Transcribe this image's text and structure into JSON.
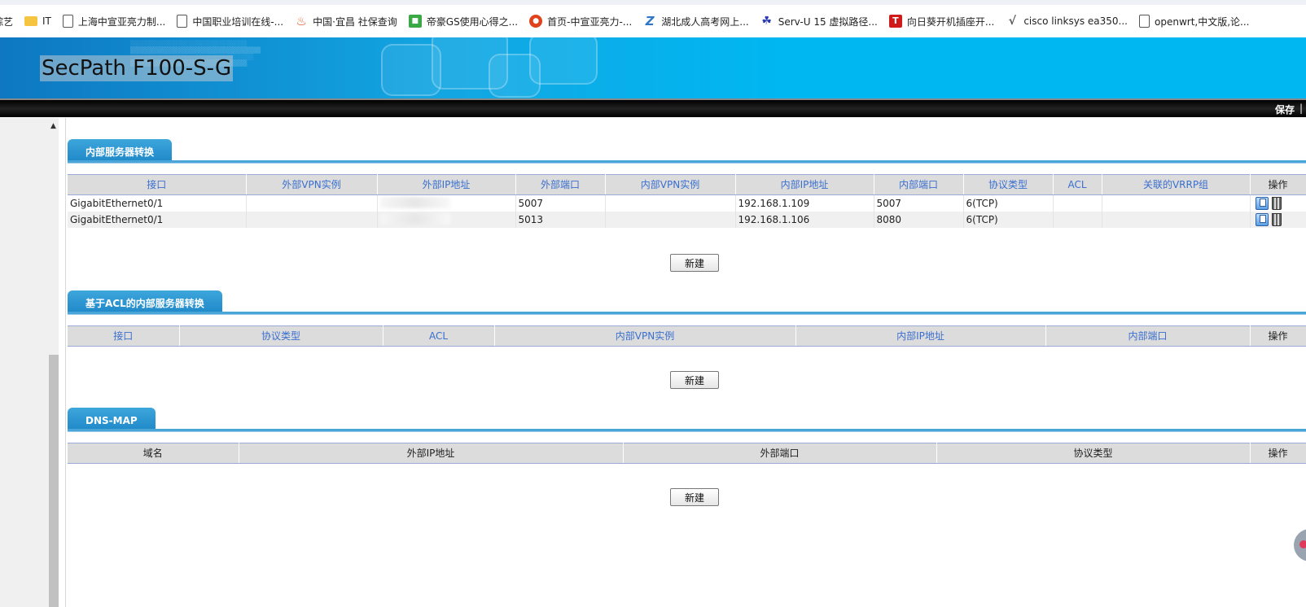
{
  "bookmarks": [
    {
      "label": "综艺",
      "icon": "none"
    },
    {
      "label": "IT",
      "icon": "folder-icon"
    },
    {
      "label": "上海中宣亚亮力制...",
      "icon": "document-icon"
    },
    {
      "label": "中国职业培训在线-...",
      "icon": "document-icon"
    },
    {
      "label": "中国·宜昌 社保查询",
      "icon": "flame-icon"
    },
    {
      "label": "帝豪GS使用心得之...",
      "icon": "green-logo-icon"
    },
    {
      "label": "首页-中宣亚亮力-...",
      "icon": "red-logo-icon"
    },
    {
      "label": "湖北成人高考网上...",
      "icon": "z-logo-icon"
    },
    {
      "label": "Serv-U 15 虚拟路径...",
      "icon": "paw-icon"
    },
    {
      "label": "向日葵开机插座开...",
      "icon": "t-logo-icon"
    },
    {
      "label": "cisco linksys ea350...",
      "icon": "cisco-icon"
    },
    {
      "label": "openwrt,中文版,论...",
      "icon": "document-icon"
    }
  ],
  "header": {
    "product_title": "SecPath F100-S-G",
    "save_label": "保存",
    "separator": "|"
  },
  "colors": {
    "banner_blue": "#00b7f1",
    "tab_blue": "#1f88c9",
    "header_text": "#3a6fd0",
    "toolbar": "#000000"
  },
  "sections": {
    "internal_server": {
      "title": "内部服务器转换",
      "columns": [
        "接口",
        "外部VPN实例",
        "外部IP地址",
        "外部端口",
        "内部VPN实例",
        "内部IP地址",
        "内部端口",
        "协议类型",
        "ACL",
        "关联的VRRP组",
        "操作"
      ],
      "rows": [
        {
          "interface": "GigabitEthernet0/1",
          "ext_vpn": "",
          "ext_ip": "",
          "ext_port": "5007",
          "int_vpn": "",
          "int_ip": "192.168.1.109",
          "int_port": "5007",
          "protocol": "6(TCP)",
          "acl": "",
          "vrrp": ""
        },
        {
          "interface": "GigabitEthernet0/1",
          "ext_vpn": "",
          "ext_ip": "",
          "ext_port": "5013",
          "int_vpn": "",
          "int_ip": "192.168.1.106",
          "int_port": "8080",
          "protocol": "6(TCP)",
          "acl": "",
          "vrrp": ""
        }
      ],
      "new_button": "新建"
    },
    "acl_internal_server": {
      "title": "基于ACL的内部服务器转换",
      "columns": [
        "接口",
        "协议类型",
        "ACL",
        "内部VPN实例",
        "内部IP地址",
        "内部端口",
        "操作"
      ],
      "new_button": "新建"
    },
    "dns_map": {
      "title": "DNS-MAP",
      "columns": [
        "域名",
        "外部IP地址",
        "外部端口",
        "协议类型",
        "操作"
      ],
      "new_button": "新建"
    }
  }
}
